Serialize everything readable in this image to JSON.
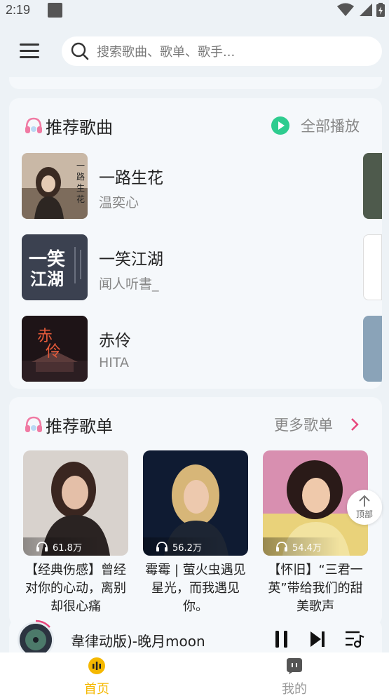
{
  "status": {
    "time": "2:19"
  },
  "search": {
    "placeholder": "搜索歌曲、歌单、歌手..."
  },
  "songs_section": {
    "title": "推荐歌曲",
    "play_all": "全部播放",
    "songs": [
      {
        "name": "一路生花",
        "artist": "温奕心",
        "cover_text": "一路生花"
      },
      {
        "name": "一笑江湖",
        "artist": "闻人听書_",
        "cover_text": "一笑江湖"
      },
      {
        "name": "赤伶",
        "artist": "HITA",
        "cover_text": "赤伶"
      }
    ]
  },
  "playlists_section": {
    "title": "推荐歌单",
    "more": "更多歌单",
    "playlists": [
      {
        "plays": "61.8万",
        "title": "【经典伤感】曾经对你的心动，离别却很心痛"
      },
      {
        "plays": "56.2万",
        "title": "霉霉 | 萤火虫遇见星光，而我遇见你。"
      },
      {
        "plays": "54.4万",
        "title": "【怀旧】“三君一英”带给我们的甜美歌声"
      }
    ]
  },
  "back_to_top": {
    "label": "顶部"
  },
  "player": {
    "now_playing": "韋律动版)-晚月moon"
  },
  "tabs": [
    {
      "label": "首页",
      "active": true
    },
    {
      "label": "我的",
      "active": false
    }
  ],
  "colors": {
    "accent": "#f5b800",
    "play_green": "#2ecc8f",
    "chevron_pink": "#e8467c"
  }
}
